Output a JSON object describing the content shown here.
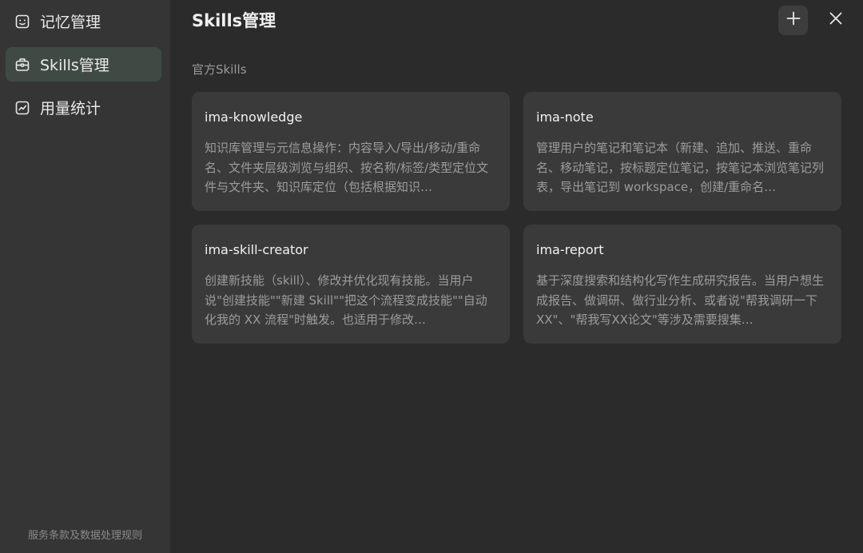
{
  "sidebar": {
    "items": [
      {
        "label": "记忆管理",
        "icon": "robot-face-icon"
      },
      {
        "label": "Skills管理",
        "icon": "toolbox-icon"
      },
      {
        "label": "用量统计",
        "icon": "chart-icon"
      }
    ],
    "footer_link": "服务条款及数据处理规则"
  },
  "header": {
    "title": "Skills管理"
  },
  "section": {
    "label": "官方Skills"
  },
  "cards": [
    {
      "title": "ima-knowledge",
      "description": "知识库管理与元信息操作：内容导入/导出/移动/重命名、文件夹层级浏览与组织、按名称/标签/类型定位文件与文件夹、知识库定位（包括根据知识…"
    },
    {
      "title": "ima-note",
      "description": "管理用户的笔记和笔记本（新建、追加、推送、重命名、移动笔记，按标题定位笔记，按笔记本浏览笔记列表，导出笔记到 workspace，创建/重命名…"
    },
    {
      "title": "ima-skill-creator",
      "description": "创建新技能（skill）、修改并优化现有技能。当用户说\"创建技能\"\"新建 Skill\"\"把这个流程变成技能\"\"自动化我的 XX 流程\"时触发。也适用于修改…"
    },
    {
      "title": "ima-report",
      "description": "基于深度搜索和结构化写作生成研究报告。当用户想生成报告、做调研、做行业分析、或者说\"帮我调研一下XX\"、\"帮我写XX论文\"等涉及需要搜集…"
    }
  ],
  "colors": {
    "sidebar_bg": "#353535",
    "main_bg": "#2b2b2b",
    "card_bg": "#3a3a3a",
    "active_item_bg": "#3f4a44"
  }
}
